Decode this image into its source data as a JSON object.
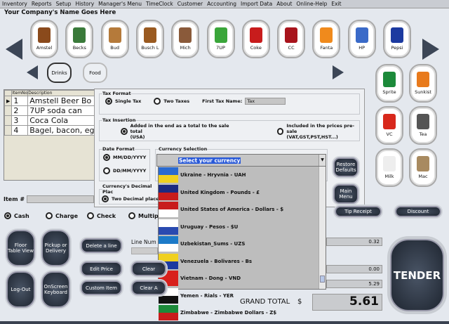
{
  "menu": [
    "Inventory",
    "Reports",
    "Setup",
    "History",
    "Manager's Menu",
    "TimeClock",
    "Customer",
    "Accounting",
    "Import Data",
    "About",
    "Online-Help",
    "Exit"
  ],
  "company": "Your Company's Name Goes Here",
  "products": [
    {
      "label": "Amstel",
      "color": "#8a4a1c"
    },
    {
      "label": "Becks",
      "color": "#3a7a3a"
    },
    {
      "label": "Bud",
      "color": "#b57a3a"
    },
    {
      "label": "Busch L",
      "color": "#9a5a20"
    },
    {
      "label": "Mich",
      "color": "#8a5a3a"
    },
    {
      "label": "7UP",
      "color": "#3aa63a"
    },
    {
      "label": "Coke",
      "color": "#c81c1c"
    },
    {
      "label": "CC",
      "color": "#a8141c"
    },
    {
      "label": "Fanta",
      "color": "#f08a1c"
    },
    {
      "label": "HP",
      "color": "#3a6ac8"
    },
    {
      "label": "Pepsi",
      "color": "#1c3aa0"
    }
  ],
  "categories": [
    "Drinks",
    "Food"
  ],
  "side_products": [
    {
      "label": "Sprite",
      "color": "#1c8a3a"
    },
    {
      "label": "Sunkist",
      "color": "#e87a1c"
    },
    {
      "label": "VC",
      "color": "#d8281c"
    },
    {
      "label": "Tea",
      "color": "#555"
    },
    {
      "label": "Milk",
      "color": "#eee"
    },
    {
      "label": "Mac",
      "color": "#a88a60"
    }
  ],
  "grid": {
    "headers": [
      "ItemNo",
      "Description"
    ],
    "rows": [
      [
        "1",
        "Amstell Beer Bo"
      ],
      [
        "2",
        "7UP soda can"
      ],
      [
        "3",
        "Coca Cola"
      ],
      [
        "4",
        "Bagel, bacon, eg"
      ]
    ]
  },
  "dialog": {
    "tax_format": "Tax Format",
    "single_tax": "Single Tax",
    "two_taxes": "Two Taxes",
    "first_tax_name_label": "First Tax Name:",
    "first_tax_name": "Tax",
    "tax_insertion": "Tax Insertion",
    "added_end": "Added in the end as a total to the sale total",
    "added_end2": "(USA)",
    "included": "Included in the prices pre-sale",
    "included2": "(VAT,GST,PST,HST...)",
    "date_format": "Date Format",
    "mmdd": "MM/DD/YYYY",
    "ddmm": "DD/MM/YYYY",
    "currency_selection": "Currency Selection",
    "currency_value": "Select your currency",
    "decimal": "Currency's Decimal Plac",
    "two_decimal": "Two Decimal place",
    "restore": "Restore Defaults",
    "main_menu": "Main Menu"
  },
  "currencies": [
    {
      "label": "Ukraine - Hryvnia - UAH",
      "colors": [
        "#2a6ad0",
        "#f0d020"
      ]
    },
    {
      "label": "United Kingdom - Pounds - £",
      "colors": [
        "#1c2a80",
        "#c81c1c"
      ]
    },
    {
      "label": "United States of America - Dollars - $",
      "colors": [
        "#c81c1c",
        "#fff"
      ]
    },
    {
      "label": "Uruguay - Pesos - $U",
      "colors": [
        "#fff",
        "#2a4ab0"
      ]
    },
    {
      "label": "Uzbekistan_Sums - UZS",
      "colors": [
        "#1c7ac8",
        "#fff"
      ]
    },
    {
      "label": "Venezuela - Bolivares - Bs",
      "colors": [
        "#f0d020",
        "#1c3aa0"
      ]
    },
    {
      "label": "Vietnam - Dong - VND",
      "colors": [
        "#d8201c",
        "#d8201c"
      ]
    },
    {
      "label": "Yemen - Rials - YER",
      "colors": [
        "#fff",
        "#111"
      ]
    },
    {
      "label": "Zimbabwe - Zimbabwe Dollars - Z$",
      "colors": [
        "#1c8a3a",
        "#c81c1c"
      ]
    }
  ],
  "item_label": "Item #",
  "payment": [
    "Cash",
    "Charge",
    "Check",
    "Multip"
  ],
  "buttons": {
    "floor": "Floor Table View",
    "pickup": "Pickup or Delivery",
    "logout": "Log-Out",
    "keyboard": "OnScreen Keyboard",
    "delete": "Delete a line",
    "edit": "Edit Price",
    "custom": "Custom Item",
    "clear1": "Clear",
    "clear2": "Clear A",
    "tip": "Tip Receipt",
    "discount": "Discount",
    "tender": "TENDER"
  },
  "line_num": "Line Num",
  "totals": {
    "v1": "0.32",
    "v2": "0.00",
    "v3": "5.29",
    "grand_label": "GRAND TOTAL",
    "currency": "$",
    "grand": "5.61"
  }
}
